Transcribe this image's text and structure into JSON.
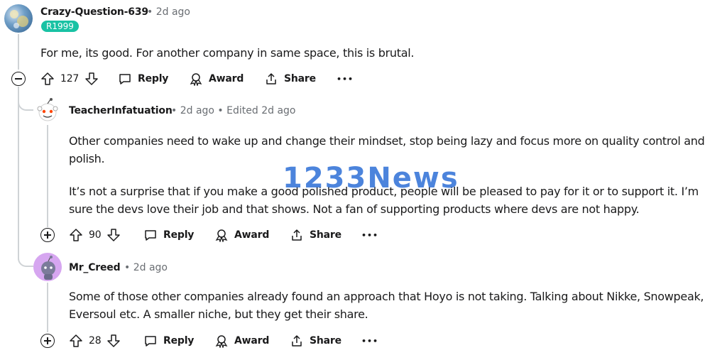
{
  "comments": [
    {
      "username": "Crazy-Question-639",
      "time": "• 2d ago",
      "flair": "R1999",
      "text": "For me, its good. For another company in same space, this is brutal.",
      "votes": "127",
      "actions": {
        "reply": "Reply",
        "award": "Award",
        "share": "Share",
        "more": "•••"
      }
    },
    {
      "username": "TeacherInfatuation",
      "time": "• 2d ago • Edited 2d ago",
      "paragraphs": [
        "Other companies need to wake up and change their mindset, stop being lazy and focus more on quality control and polish.",
        "It’s not a surprise that if you make a good polished product, people will be pleased to pay for it or to support it. I’m sure the devs love their job and that shows. Not a fan of supporting products where devs are not happy."
      ],
      "votes": "90",
      "actions": {
        "reply": "Reply",
        "award": "Award",
        "share": "Share",
        "more": "•••"
      }
    },
    {
      "username": "Mr_Creed",
      "time": "• 2d ago",
      "text": "Some of those other companies already found an approach that Hoyo is not taking. Talking about Nikke, Snowpeak, Eversoul etc. A smaller niche, but they get their share.",
      "votes": "28",
      "actions": {
        "reply": "Reply",
        "award": "Award",
        "share": "Share",
        "more": "•••"
      }
    }
  ],
  "watermark": "1233News",
  "colors": {
    "flair": "#19c2a4",
    "watermark": "#2d6fd6",
    "meta": "#6a6e73"
  }
}
